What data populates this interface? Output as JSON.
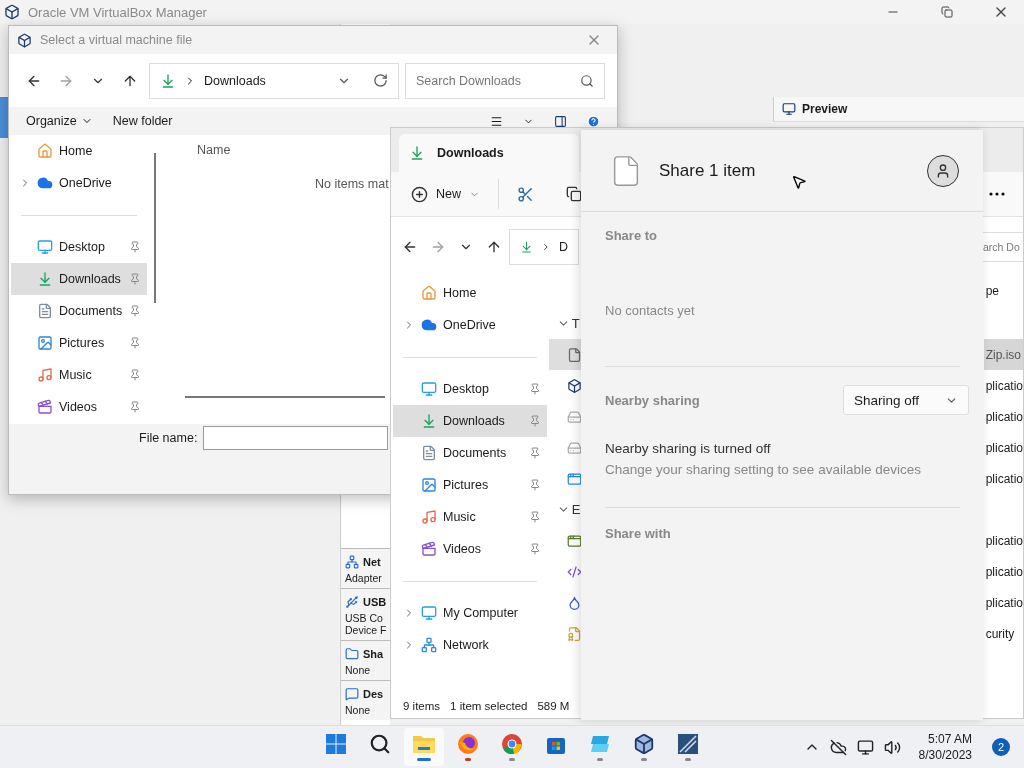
{
  "manager": {
    "title": "Oracle VM VirtualBox Manager",
    "preview": "Preview",
    "details": [
      {
        "kind": "network",
        "title": "Net",
        "lines": [
          "Adapter"
        ]
      },
      {
        "kind": "usb",
        "title": "USB",
        "lines": [
          "USB Co",
          "Device F"
        ]
      },
      {
        "kind": "folder",
        "title": "Sha",
        "lines": [
          "None"
        ]
      },
      {
        "kind": "chat",
        "title": "Des",
        "lines": [
          "None"
        ]
      }
    ]
  },
  "file_dialog": {
    "title": "Select a virtual machine file",
    "location": "Downloads",
    "search": {
      "placeholder": "Search Downloads"
    },
    "toolbar": [
      "Organize",
      "New folder"
    ],
    "nav_groups": [
      [
        {
          "label": "Home",
          "kind": "home",
          "expandable": false,
          "pinned": false,
          "selected": false
        },
        {
          "label": "OneDrive",
          "kind": "onedrive",
          "expandable": true,
          "pinned": false,
          "selected": false
        }
      ],
      [
        {
          "label": "Desktop",
          "kind": "desktop",
          "expandable": false,
          "pinned": true,
          "selected": false
        },
        {
          "label": "Downloads",
          "kind": "downloads",
          "expandable": false,
          "pinned": true,
          "selected": true
        },
        {
          "label": "Documents",
          "kind": "documents",
          "expandable": false,
          "pinned": true,
          "selected": false
        },
        {
          "label": "Pictures",
          "kind": "pictures",
          "expandable": false,
          "pinned": true,
          "selected": false
        },
        {
          "label": "Music",
          "kind": "music",
          "expandable": false,
          "pinned": true,
          "selected": false
        },
        {
          "label": "Videos",
          "kind": "videos",
          "expandable": false,
          "pinned": true,
          "selected": false
        }
      ]
    ],
    "column": "Name",
    "empty_message": "No items mat",
    "file_name": {
      "label": "File name:"
    }
  },
  "explorer": {
    "tab": "Downloads",
    "new_button": "New",
    "location": "D",
    "search": {
      "placeholder": "arch Do"
    },
    "nav_groups": [
      [
        {
          "label": "Home",
          "kind": "home",
          "expandable": false,
          "pinned": false,
          "selected": false
        },
        {
          "label": "OneDrive",
          "kind": "onedrive",
          "expandable": true,
          "pinned": false,
          "selected": false
        }
      ],
      [
        {
          "label": "Desktop",
          "kind": "desktop",
          "expandable": false,
          "pinned": true,
          "selected": false
        },
        {
          "label": "Downloads",
          "kind": "downloads",
          "expandable": false,
          "pinned": true,
          "selected": true
        },
        {
          "label": "Documents",
          "kind": "documents",
          "expandable": false,
          "pinned": true,
          "selected": false
        },
        {
          "label": "Pictures",
          "kind": "pictures",
          "expandable": false,
          "pinned": true,
          "selected": false
        },
        {
          "label": "Music",
          "kind": "music",
          "expandable": false,
          "pinned": true,
          "selected": false
        },
        {
          "label": "Videos",
          "kind": "videos",
          "expandable": false,
          "pinned": true,
          "selected": false
        }
      ],
      [
        {
          "label": "My Computer",
          "kind": "computer",
          "expandable": true,
          "pinned": false,
          "selected": false
        },
        {
          "label": "Network",
          "kind": "network",
          "expandable": true,
          "pinned": false,
          "selected": false
        }
      ]
    ],
    "column": "pe",
    "groups": [
      {
        "label": "T",
        "rows": [
          {
            "kind": "file",
            "type": "Zip.iso",
            "selected": true
          },
          {
            "kind": "cube",
            "type": "plicatio",
            "selected": false
          },
          {
            "kind": "drive",
            "type": "plicatio",
            "selected": false
          },
          {
            "kind": "drive",
            "type": "plicatio",
            "selected": false
          },
          {
            "kind": "app",
            "type": "plicatio",
            "selected": false
          }
        ]
      },
      {
        "label": "E",
        "rows": [
          {
            "kind": "window",
            "type": "plicatio",
            "selected": false
          },
          {
            "kind": "code",
            "type": "plicatio",
            "selected": false
          },
          {
            "kind": "drop",
            "type": "plicatio",
            "selected": false
          },
          {
            "kind": "badge",
            "type": "curity",
            "selected": false
          }
        ]
      }
    ],
    "status": [
      "9 items",
      "1 item selected",
      "589 M"
    ]
  },
  "share": {
    "title": "Share 1 item",
    "share_to": "Share to",
    "no_contacts": "No contacts yet",
    "nearby_label": "Nearby sharing",
    "nearby_value": "Sharing off",
    "nearby_status": "Nearby sharing is turned off",
    "nearby_hint": "Change your sharing setting to see available devices",
    "share_with": "Share with"
  },
  "taskbar": {
    "apps": [
      {
        "kind": "start",
        "active": false,
        "running": false
      },
      {
        "kind": "search",
        "active": false,
        "running": false
      },
      {
        "kind": "explorer",
        "active": true,
        "running": true
      },
      {
        "kind": "firefox",
        "active": false,
        "running": true
      },
      {
        "kind": "chrome",
        "active": false,
        "running": true
      },
      {
        "kind": "store",
        "active": false,
        "running": false
      },
      {
        "kind": "app",
        "active": false,
        "running": true
      },
      {
        "kind": "vbox",
        "active": false,
        "running": true
      },
      {
        "kind": "xp",
        "active": false,
        "running": true
      }
    ],
    "time": "5:07 AM",
    "date": "8/30/2023",
    "badge": "2"
  }
}
